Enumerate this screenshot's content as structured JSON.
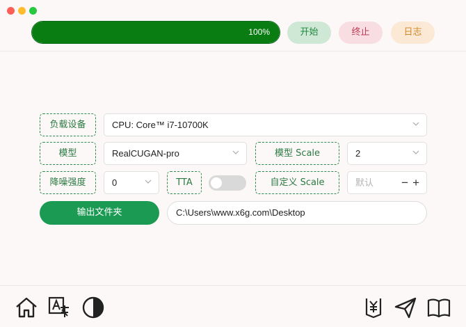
{
  "window": {
    "controls": [
      "close",
      "minimize",
      "maximize"
    ]
  },
  "progress": {
    "percent_label": "100%",
    "fraction": 1.0
  },
  "toolbar": {
    "start_label": "开始",
    "stop_label": "终止",
    "log_label": "日志"
  },
  "device": {
    "label": "负载设备",
    "value": "CPU: Core™ i7-10700K"
  },
  "model": {
    "label": "模型",
    "value": "RealCUGAN-pro"
  },
  "model_scale": {
    "label": "模型 Scale",
    "value": "2"
  },
  "denoise": {
    "label": "降噪强度",
    "value": "0"
  },
  "tta": {
    "label": "TTA"
  },
  "custom_scale": {
    "label": "自定义 Scale",
    "placeholder": "默认",
    "minus": "−",
    "plus": "+"
  },
  "output": {
    "button_label": "输出文件夹",
    "path": "C:\\Users\\www.x6g.com\\Desktop"
  },
  "footer": {
    "icons": [
      "home-icon",
      "translate-icon",
      "theme-contrast-icon",
      "donate-icon",
      "send-icon",
      "book-icon"
    ]
  },
  "colors": {
    "accent": "#1a9a52",
    "progress": "#0a7d12"
  }
}
